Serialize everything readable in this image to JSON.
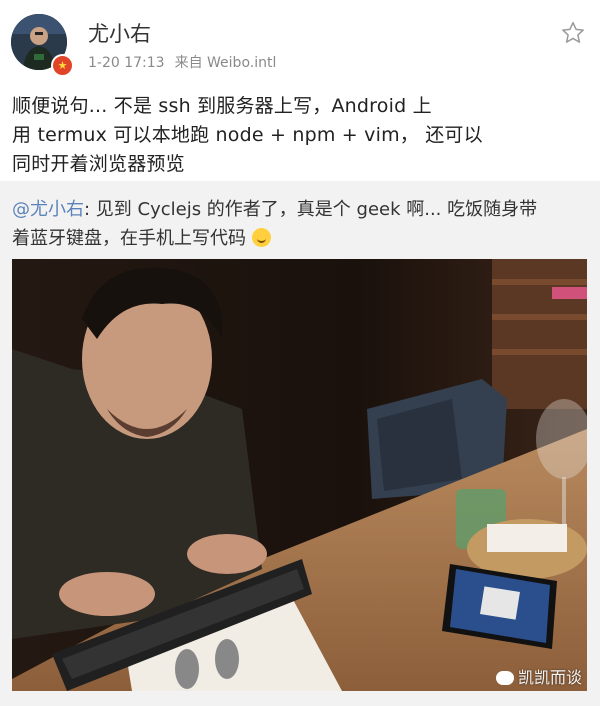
{
  "post": {
    "author": "尤小右",
    "timestamp": "1-20 17:13",
    "source": "来自 Weibo.intl",
    "text_lines": [
      "顺便说句... 不是 ssh 到服务器上写，Android 上",
      "用 termux 可以本地跑 node + npm + vim， 还可以",
      "同时开着浏览器预览"
    ]
  },
  "repost": {
    "mention": "@尤小右",
    "line1_rest": ": 见到 Cyclejs 的作者了，真是个 geek 啊... 吃饭随身带",
    "line2": "着蓝牙键盘，在手机上写代码",
    "emoji": "laughing-emoji"
  },
  "watermark": "凯凯而谈",
  "icons": {
    "favorite": "star-outline-icon",
    "verified": "verified-badge-icon"
  },
  "colors": {
    "mention": "#5b83ba",
    "meta": "#8a8a8a",
    "badge": "#e0452a",
    "repost_bg": "#f2f2f2"
  }
}
